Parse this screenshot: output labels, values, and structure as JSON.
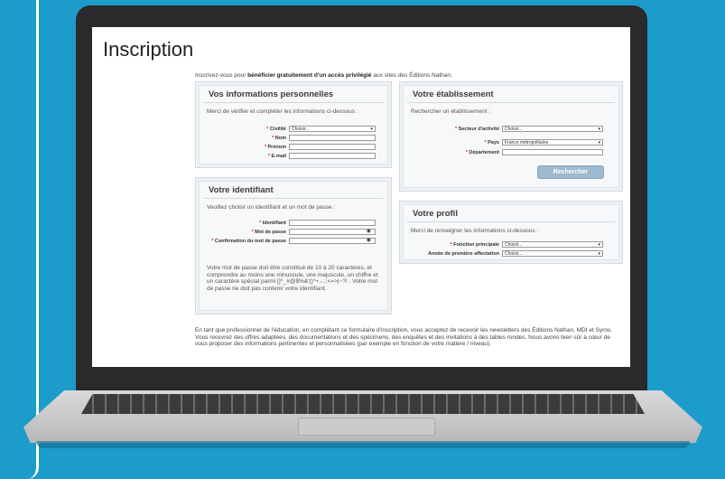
{
  "page": {
    "title": "Inscription",
    "intro_prefix": "Inscrivez-vous pour",
    "intro_bold": "bénéficier gratuitement d'un accès privilégié",
    "intro_suffix": "aux sites des Éditions Nathan."
  },
  "personal": {
    "title": "Vos informations personnelles",
    "text": "Merci de vérifier et compléter les informations ci-dessous :",
    "civilite_label": "Civilité",
    "civilite_value": "Choisir...",
    "nom_label": "Nom",
    "prenom_label": "Prénom",
    "email_label": "E-mail"
  },
  "etablissement": {
    "title": "Votre établissement",
    "text": "Rechercher un établissement :",
    "secteur_label": "Secteur d'activité",
    "secteur_value": "Choisir...",
    "pays_label": "Pays",
    "pays_value": "France métropolitaine",
    "departement_label": "Département",
    "search_button": "Rechercher"
  },
  "identifiant": {
    "title": "Votre identifiant",
    "text": "Veuillez choisir un identifiant et un mot de passe :",
    "identifiant_label": "Identifiant",
    "password_label": "Mot de passe",
    "confirm_label": "Confirmation du mot de passe",
    "note": "Votre mot de passe doit être constitué de 10 à 20 caractères, et comprendre au moins une minuscule, une majuscule, un chiffre et un caractère spécial parmi []^_#@$%&'()*+,-.:;<=>|~?! . Votre mot de passe ne doit pas contenir votre identifiant."
  },
  "profil": {
    "title": "Votre profil",
    "text": "Merci de renseigner les informations ci-dessous :",
    "fonction_label": "Fonction principale",
    "fonction_value": "Choisir...",
    "annee_label": "Année de première affectation",
    "annee_value": "Choisir..."
  },
  "footer": {
    "text": "En tant que professionnel de l'éducation, en complétant ce formulaire d'inscription, vous acceptez de recevoir les newsletters des Éditions Nathan, MDI et Syros. Vous recevrez des offres adaptées, des documentations et des spécimens, des enquêtes et des invitations à des tables rondes. Nous avons bien sûr à cœur de vous proposer des informations pertinentes et personnalisées (par exemple en fonction de votre matière / niveau)."
  },
  "icons": {
    "eye": "eye-icon",
    "select_arrow": "chevron-down-icon"
  },
  "colors": {
    "background": "#1c9ccb",
    "button": "#9fb9cf"
  }
}
